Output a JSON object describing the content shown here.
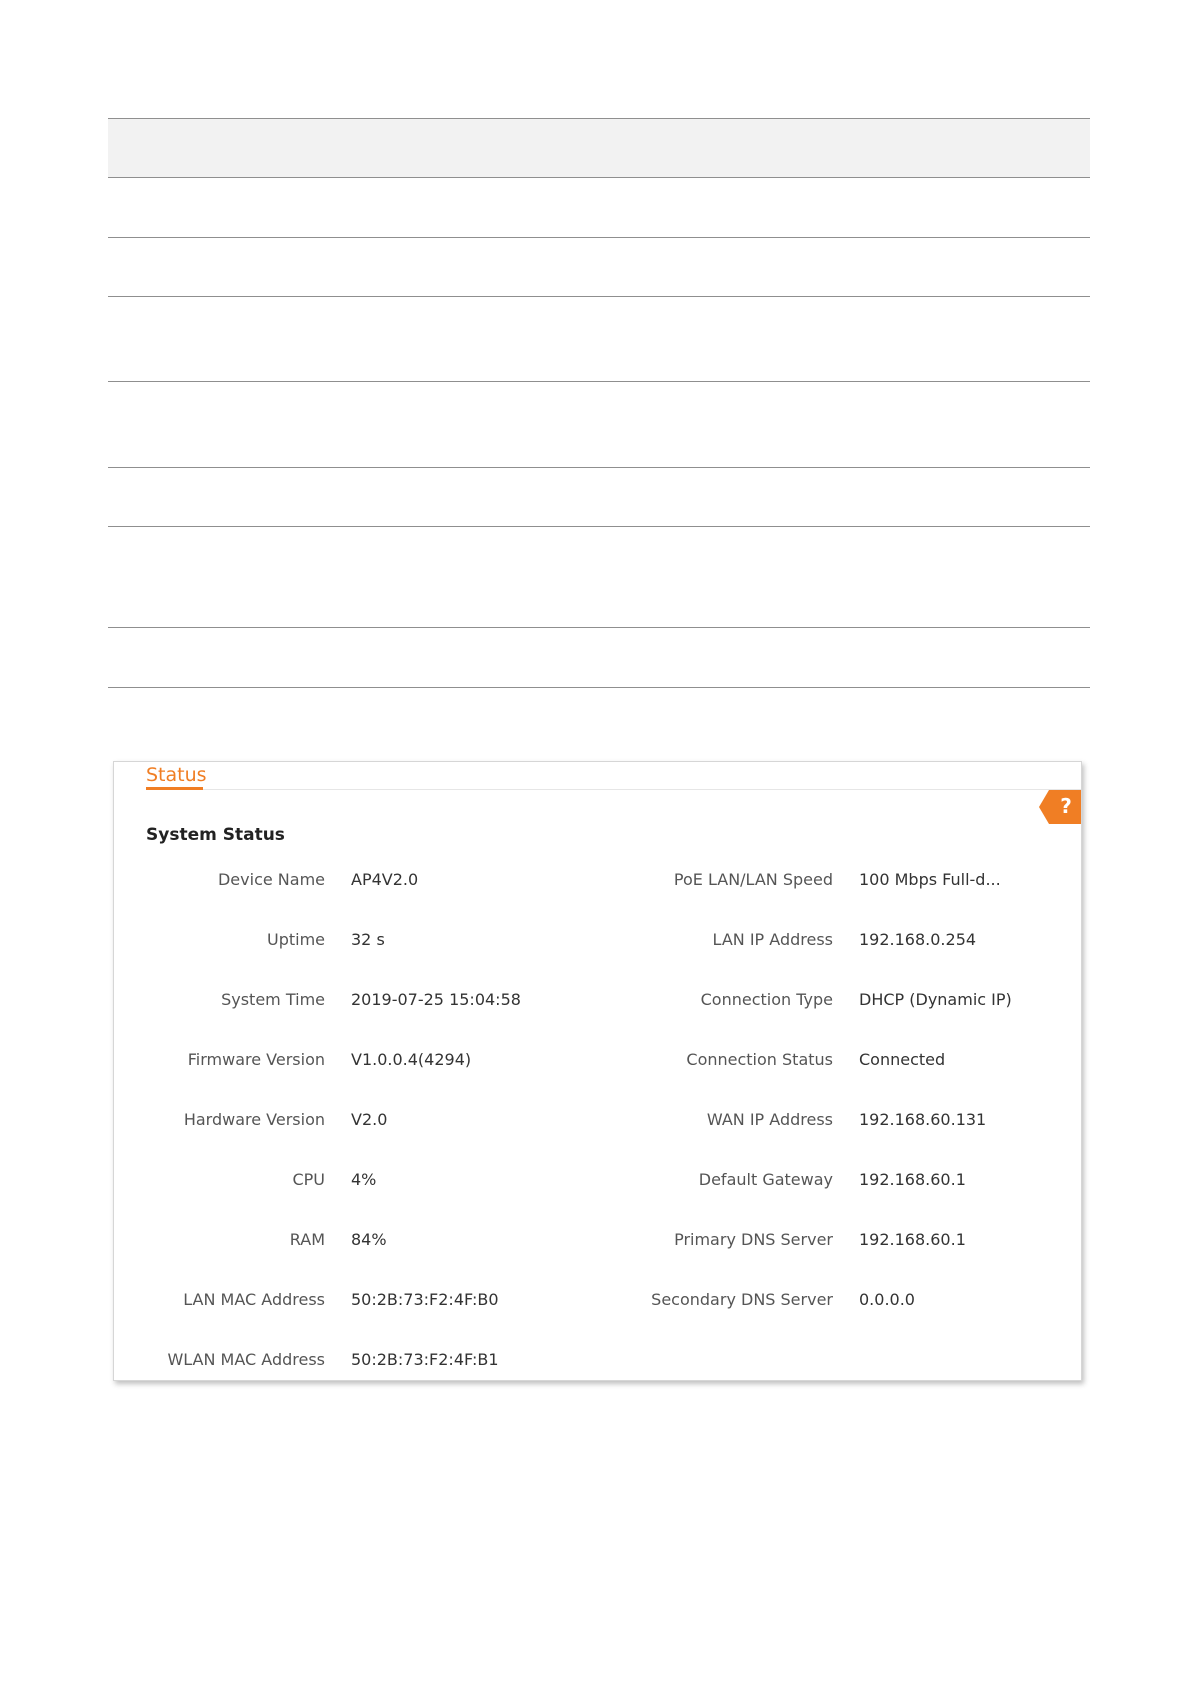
{
  "doc_table": {
    "rows": 9
  },
  "panel": {
    "tab_label": "Status",
    "help_label": "?",
    "section_title": "System Status",
    "left_fields": [
      {
        "label": "Device Name",
        "value": "AP4V2.0"
      },
      {
        "label": "Uptime",
        "value": "32 s"
      },
      {
        "label": "System Time",
        "value": "2019-07-25 15:04:58"
      },
      {
        "label": "Firmware Version",
        "value": "V1.0.0.4(4294)"
      },
      {
        "label": "Hardware Version",
        "value": "V2.0"
      },
      {
        "label": "CPU",
        "value": "4%"
      },
      {
        "label": "RAM",
        "value": "84%"
      },
      {
        "label": "LAN MAC Address",
        "value": "50:2B:73:F2:4F:B0"
      },
      {
        "label": "WLAN MAC Address",
        "value": "50:2B:73:F2:4F:B1"
      }
    ],
    "right_fields": [
      {
        "label": "PoE LAN/LAN Speed",
        "value": "100 Mbps Full-d..."
      },
      {
        "label": "LAN IP Address",
        "value": "192.168.0.254"
      },
      {
        "label": "Connection Type",
        "value": "DHCP (Dynamic IP)"
      },
      {
        "label": "Connection Status",
        "value": "Connected"
      },
      {
        "label": "WAN IP Address",
        "value": "192.168.60.131"
      },
      {
        "label": "Default Gateway",
        "value": "192.168.60.1"
      },
      {
        "label": "Primary DNS Server",
        "value": "192.168.60.1"
      },
      {
        "label": "Secondary DNS Server",
        "value": "0.0.0.0"
      }
    ]
  },
  "colors": {
    "accent": "#f07e24",
    "table_header_bg": "#f2f2f2",
    "rule": "#8f8f8f"
  }
}
